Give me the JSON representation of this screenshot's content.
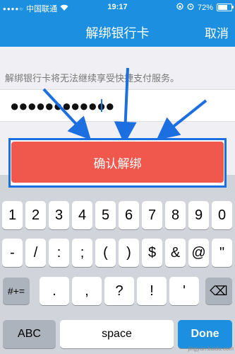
{
  "status": {
    "carrier": "中国联通",
    "time": "19:17",
    "battery": "72%",
    "battery_level": 0.72
  },
  "nav": {
    "title": "解绑银行卡",
    "cancel": "取消"
  },
  "main": {
    "notice": "解绑银行卡将无法继续享受快捷支付服务。",
    "password_dots": "●●●●●●●●●●●●"
  },
  "confirm_button": "确认解绑",
  "keyboard": {
    "row1": [
      "1",
      "2",
      "3",
      "4",
      "5",
      "6",
      "7",
      "8",
      "9",
      "0"
    ],
    "row2": [
      "-",
      "/",
      ":",
      ";",
      "(",
      ")",
      "$",
      "&",
      "@",
      "\""
    ],
    "row3_left": "#+=",
    "row3": [
      ".",
      ",",
      "?",
      "!",
      "'"
    ],
    "backspace": "⌫",
    "abc": "ABC",
    "space": "space",
    "done": "Done"
  },
  "watermark": "jingyan.baidu.com",
  "colors": {
    "brand_blue": "#1c8fe0",
    "confirm_red": "#f0584d",
    "highlight_blue": "#1c6fe0"
  }
}
